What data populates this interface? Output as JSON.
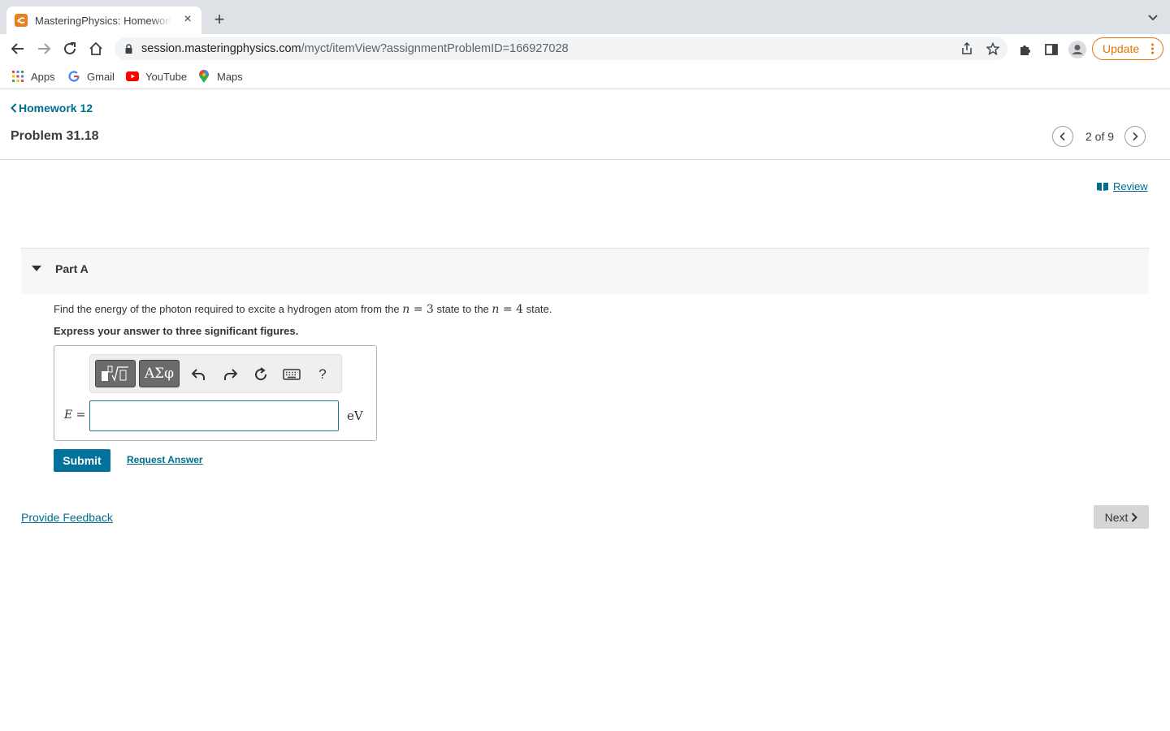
{
  "browser": {
    "tab_title": "MasteringPhysics: Homework 12",
    "tab_close": "×",
    "new_tab": "+",
    "url_host": "session.masteringphysics.com",
    "url_path": "/myct/itemView?assignmentProblemID=166927028",
    "update_label": "Update",
    "bookmarks": [
      {
        "label": "Apps",
        "icon": "apps-grid-icon"
      },
      {
        "label": "Gmail",
        "icon": "google-g-icon"
      },
      {
        "label": "YouTube",
        "icon": "youtube-icon"
      },
      {
        "label": "Maps",
        "icon": "maps-pin-icon"
      }
    ],
    "colors": {
      "update_accent": "#e37400",
      "tab_strip": "#dee1e6"
    }
  },
  "page": {
    "back_link": "Homework 12",
    "problem_title": "Problem 31.18",
    "pager": {
      "current": 2,
      "total": 9,
      "text": "2 of 9"
    },
    "review_label": "Review",
    "part": {
      "title": "Part A",
      "question_prefix": "Find the energy of the photon required to excite a hydrogen atom from the ",
      "math_var_1": "n",
      "math_eq_1": " = 3",
      "question_middle": " state to the ",
      "math_var_2": "n",
      "math_eq_2": " = 4",
      "question_suffix": " state.",
      "instruction": "Express your answer to three significant figures.",
      "toolbar": {
        "greek_label": "ΑΣφ",
        "help_label": "?"
      },
      "variable": "E",
      "equals": " =",
      "answer_value": "",
      "unit": "eV"
    },
    "submit_label": "Submit",
    "request_answer_label": "Request Answer",
    "feedback_label": "Provide Feedback",
    "next_label": "Next",
    "colors": {
      "link": "#006d8c",
      "submit": "#00729c"
    }
  }
}
